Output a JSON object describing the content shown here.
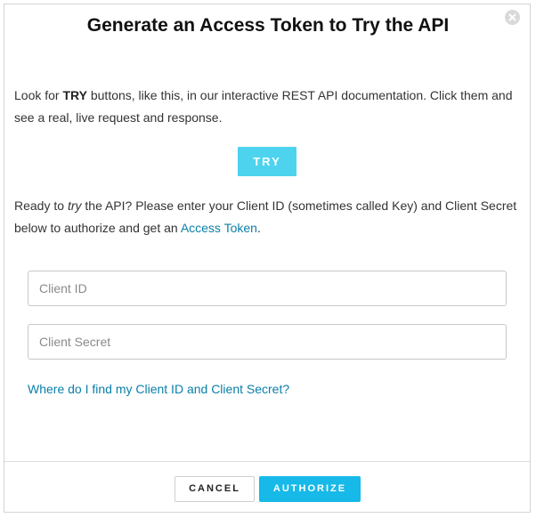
{
  "dialog": {
    "title": "Generate an Access Token to Try the API",
    "close_icon": "close-circle-icon"
  },
  "intro": {
    "before_bold": "Look for ",
    "bold": "TRY",
    "after_bold": " buttons, like this, in our interactive REST API documentation. Click them and see a real, live request and response."
  },
  "try_button": {
    "label": "TRY"
  },
  "ready": {
    "before_italic": "Ready to ",
    "italic": "try",
    "after_italic": " the API? Please enter your Client ID (sometimes called Key) and Client Secret below to authorize and get an ",
    "link": "Access Token",
    "end": "."
  },
  "form": {
    "client_id": {
      "placeholder": "Client ID",
      "value": ""
    },
    "client_secret": {
      "placeholder": "Client Secret",
      "value": ""
    }
  },
  "help_link": "Where do I find my Client ID and Client Secret?",
  "footer": {
    "cancel_label": "CANCEL",
    "authorize_label": "AUTHORIZE"
  },
  "colors": {
    "link": "#0a7fa8",
    "try_button": "#4dd3ee",
    "authorize_button": "#16b9e8"
  }
}
